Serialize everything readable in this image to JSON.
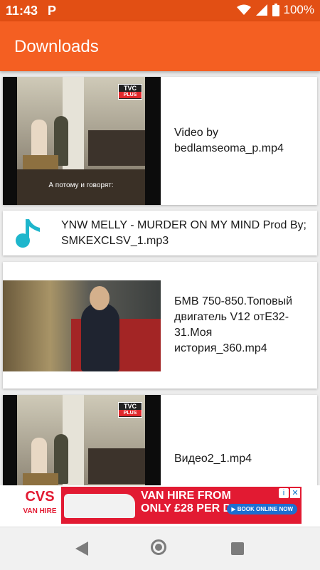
{
  "status": {
    "time": "11:43",
    "notification_glyph": "P",
    "battery": "100%",
    "icons": [
      "wifi-icon",
      "signal-icon",
      "battery-icon"
    ]
  },
  "appbar": {
    "title": "Downloads"
  },
  "downloads": [
    {
      "name": "Video by bedlamseoma_p.mp4",
      "type": "video",
      "thumb_channel": "TVC",
      "thumb_channel_sub": "PLUS",
      "thumb_caption": "А потому и говорят:"
    },
    {
      "name": "YNW MELLY - MURDER ON MY MIND Prod By; SMKEXCLSV_1.mp3",
      "type": "audio"
    },
    {
      "name": "БМВ 750-850.Топовый двигатель V12 отЕ32- 31.Моя история_360.mp4",
      "type": "video"
    },
    {
      "name": "Видео2_1.mp4",
      "type": "video",
      "thumb_channel": "TVC",
      "thumb_channel_sub": "PLUS"
    }
  ],
  "ad": {
    "brand": "CVS",
    "brand_sub": "VAN HIRE",
    "headline_1": "VAN HIRE FROM",
    "headline_2": "ONLY £28 PER DAY",
    "cta": "▶ BOOK ONLINE NOW"
  },
  "colors": {
    "statusbar": "#e24f14",
    "appbar": "#f45f22",
    "music_icon": "#1eb6cc"
  }
}
